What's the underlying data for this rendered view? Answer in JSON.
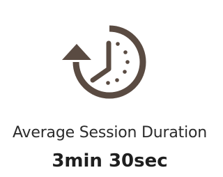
{
  "stat": {
    "icon": "clock-history-icon",
    "icon_color": "#5a4b42",
    "label": "Average Session Duration",
    "value": "3min 30sec"
  }
}
